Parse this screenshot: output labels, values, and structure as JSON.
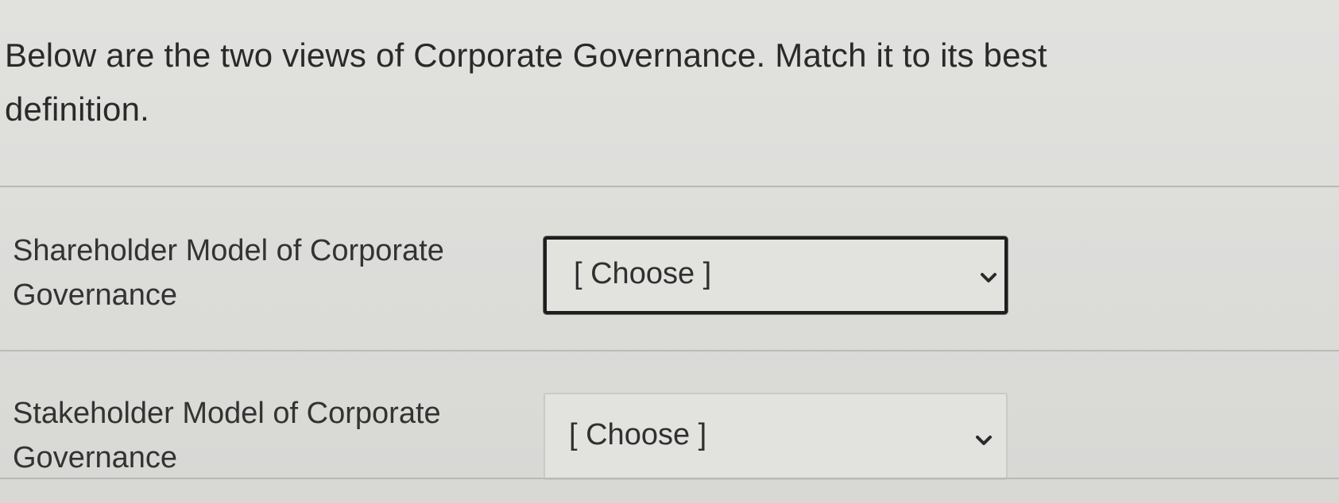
{
  "question": {
    "text": "Below are the two views of Corporate Governance.  Match it to its best definition."
  },
  "matches": [
    {
      "prompt": "Shareholder Model of Corporate Governance",
      "selected": "[ Choose ]",
      "focused": true
    },
    {
      "prompt": "Stakeholder Model of Corporate Governance",
      "selected": "[ Choose ]",
      "focused": false
    }
  ],
  "icons": {
    "dropdown": "chevron-down-icon"
  }
}
